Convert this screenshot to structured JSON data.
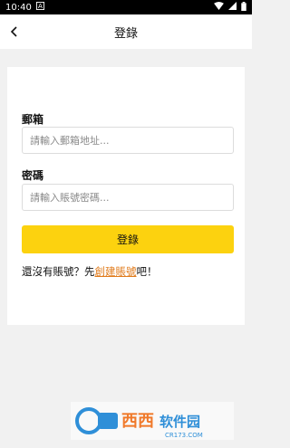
{
  "status_bar": {
    "time": "10:40"
  },
  "header": {
    "title": "登錄"
  },
  "form": {
    "email_label": "郵箱",
    "email_placeholder": "請輸入郵箱地址...",
    "password_label": "密碼",
    "password_placeholder": "請輸入賬號密碼...",
    "login_button": "登錄"
  },
  "register": {
    "prefix": "還沒有賬號？先",
    "link": "創建賬號",
    "suffix": "吧！"
  },
  "watermark": {
    "brand": "西西软件园",
    "url": "CR173.COM"
  },
  "colors": {
    "accent": "#fcd20f",
    "link": "#e07a1a"
  }
}
